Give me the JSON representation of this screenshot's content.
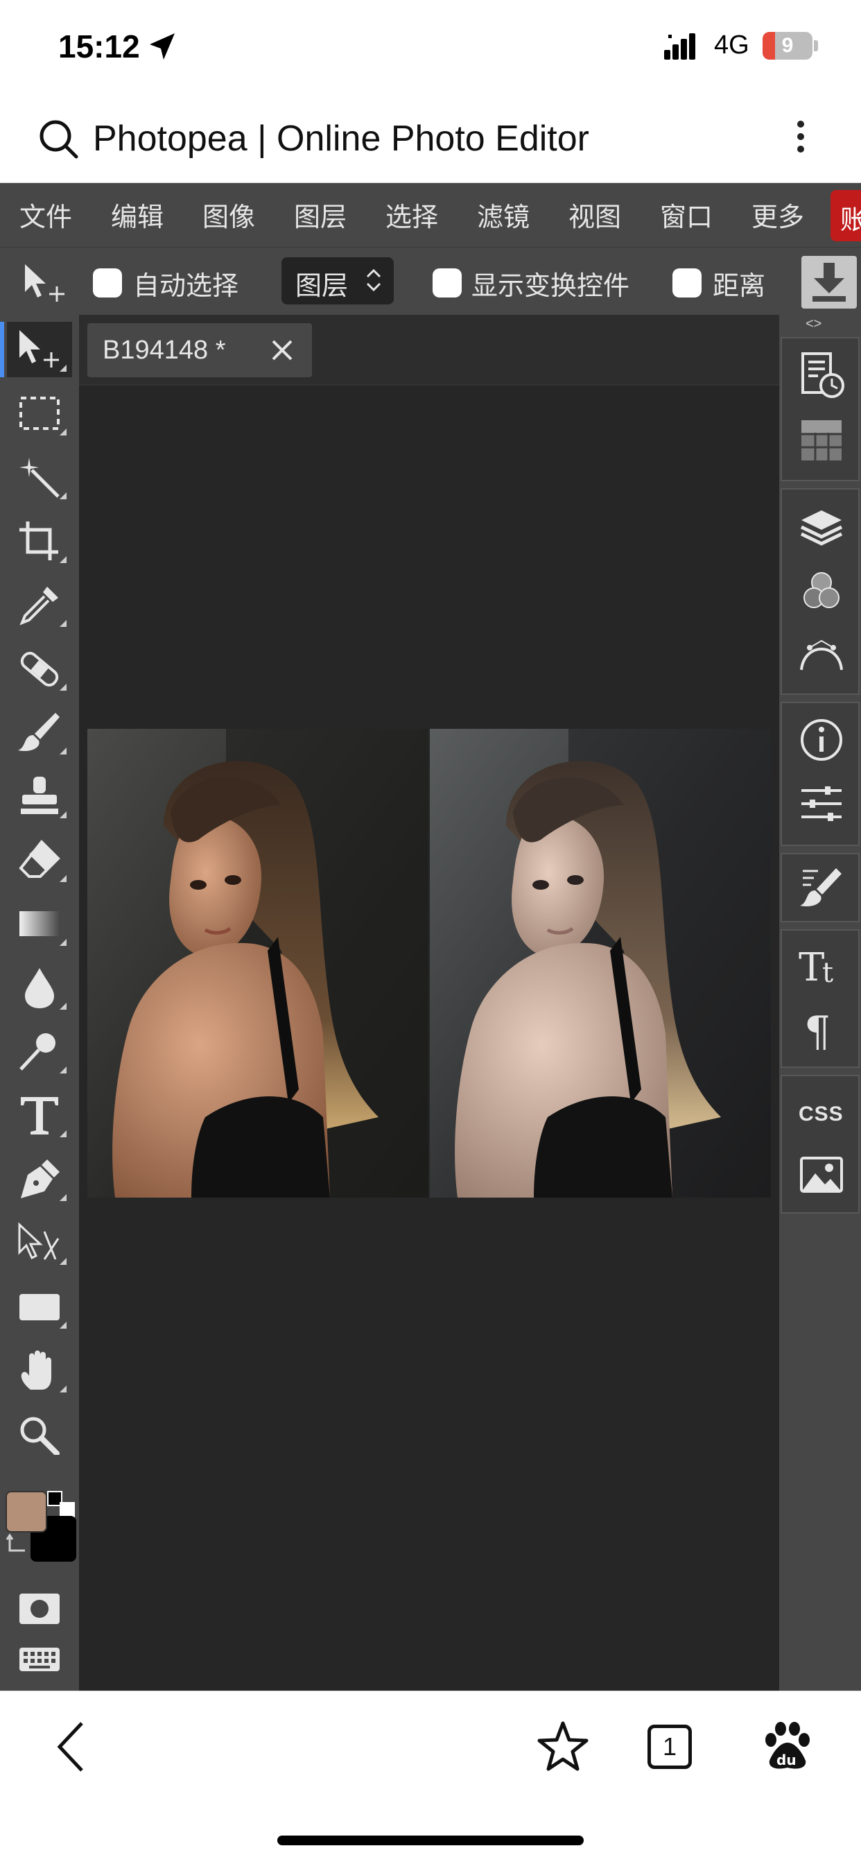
{
  "status": {
    "time": "15:12",
    "network": "4G",
    "battery": "9"
  },
  "browser": {
    "title": "Photopea | Online Photo Editor",
    "tab_count": "1"
  },
  "menu": [
    "文件",
    "编辑",
    "图像",
    "图层",
    "选择",
    "滤镜",
    "视图",
    "窗口",
    "更多",
    "账"
  ],
  "options": {
    "auto_select_label": "自动选择",
    "layer_select_value": "图层",
    "show_transform_label": "显示变换控件",
    "distance_label": "距离"
  },
  "document": {
    "tab_name": "B194148 *"
  },
  "panel": {
    "collapse_label": "<>",
    "css_label": "CSS"
  },
  "colors": {
    "foreground": "#b39077",
    "background": "#000000",
    "accent": "#4a8ef0"
  },
  "tools": [
    "move-tool",
    "marquee-tool",
    "magic-wand-tool",
    "crop-tool",
    "eyedropper-tool",
    "healing-tool",
    "brush-tool",
    "stamp-tool",
    "eraser-tool",
    "gradient-tool",
    "blur-tool",
    "dodge-tool",
    "type-tool",
    "pen-tool",
    "path-select-tool",
    "shape-tool",
    "hand-tool",
    "zoom-tool"
  ]
}
